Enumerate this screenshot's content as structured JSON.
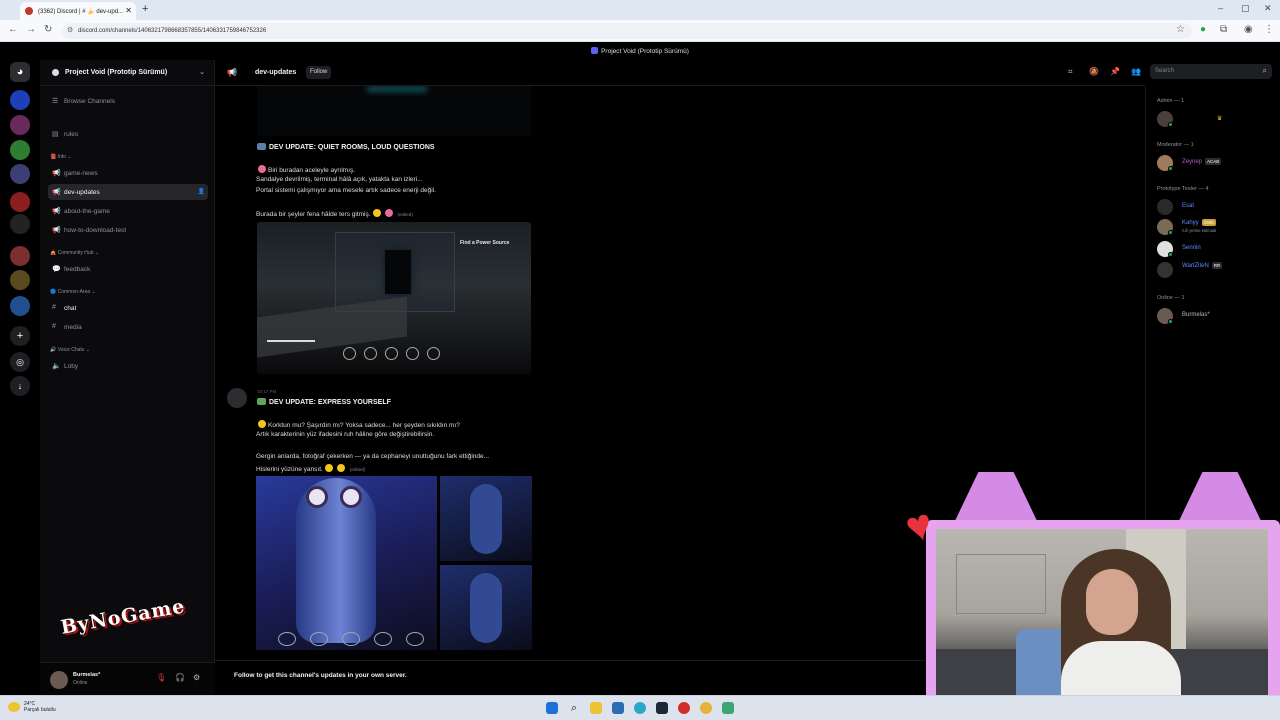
{
  "browser": {
    "tab_title": "(3362) Discord | # 🍌 dev-upd...",
    "url": "discord.com/channels/1406321798668357855/1406331759846752326"
  },
  "app_title": "Project Void (Prototip Sürümü)",
  "server": {
    "name": "Project Void (Prototip Sürümü)",
    "browse": "Browse Channels",
    "channels_top": [
      {
        "label": "rules"
      }
    ],
    "categories": [
      {
        "name": "Info",
        "channels": [
          "game-news",
          "dev-updates",
          "about-the-game",
          "how-to-download-test"
        ]
      },
      {
        "name": "Community Hub",
        "channels": [
          "feedback"
        ]
      },
      {
        "name": "Common-Area",
        "channels": [
          "chat",
          "media"
        ]
      },
      {
        "name": "Voice Chats",
        "channels": [
          "Loby"
        ]
      }
    ],
    "selected_channel": "dev-updates"
  },
  "user": {
    "name": "Burmelas*",
    "status": "Online"
  },
  "stream_logo": "ByNoGame",
  "channel": {
    "name": "dev-updates",
    "follow": "Follow",
    "search_placeholder": "Search"
  },
  "messages": [
    {
      "title": "DEV UPDATE: QUIET ROOMS, LOUD QUESTIONS",
      "lines": [
        "Biri buradan aceleyle ayrılmış.",
        "Sandalye devrilmiş, terminal hâlâ açık, yatakta kan izleri...",
        "Portal sistemi çalışmıyor ama mesele artık sadece enerji değil.",
        "Burada bir şeyler fena hâlde ters gitmiş."
      ],
      "edited": "(edited)",
      "image_label": "Find a Power Source"
    },
    {
      "time": "10:17 PM",
      "title": "DEV UPDATE: EXPRESS YOURSELF",
      "lines": [
        "Korktun mu? Şaşırdın mı? Yoksa sadece... her şeyden sıkıldın mı?",
        "Artık karakterinin yüz ifadesini ruh hâline göre değiştirebilirsin.",
        "Gergin anlarda, fotoğraf çekerken — ya da cephaneyi unuttuğunu fark ettiğinde...",
        "Hislerini yüzüne yansıt."
      ],
      "edited": "(edited)"
    }
  ],
  "follow_bar": "Follow to get this channel's updates in your own server.",
  "members": {
    "groups": [
      {
        "title": "Admin — 1",
        "members": [
          {
            "name": "",
            "color": "#e03b3b"
          }
        ]
      },
      {
        "title": "Moderator — 1",
        "members": [
          {
            "name": "Zeynep",
            "badge": "ACAB",
            "color": "#b55bd1"
          }
        ]
      },
      {
        "title": "Prototype Tester — 4",
        "members": [
          {
            "name": "Esat",
            "color": "#5b8cff"
          },
          {
            "name": "Kahyy",
            "badge": "1905",
            "sub": "ruh yerine kalmadı",
            "color": "#5b8cff"
          },
          {
            "name": "Sennin",
            "color": "#5b8cff"
          },
          {
            "name": "WartZiteN",
            "badge": "RR",
            "color": "#5b8cff"
          }
        ]
      },
      {
        "title": "Online — 1",
        "members": [
          {
            "name": "Burmelas*",
            "color": "#b5bac1"
          }
        ]
      }
    ]
  },
  "taskbar": {
    "weather_temp": "24°C",
    "weather_text": "Parçalı bulutlu"
  },
  "colors": {
    "accent": "#5865f2",
    "online": "#23a55a",
    "cam_frame": "#e6a4f0"
  }
}
